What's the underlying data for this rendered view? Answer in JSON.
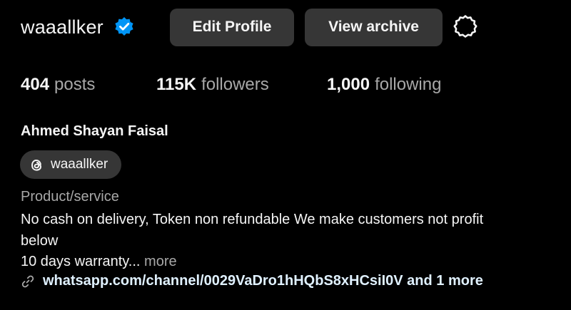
{
  "profile": {
    "username": "waaallker",
    "edit_profile_label": "Edit Profile",
    "view_archive_label": "View archive",
    "full_name": "Ahmed Shayan Faisal",
    "category": "Product/service"
  },
  "stats": {
    "posts": {
      "value": "404",
      "label": "posts"
    },
    "followers": {
      "value": "115K",
      "label": "followers"
    },
    "following": {
      "value": "1,000",
      "label": "following"
    }
  },
  "threads": {
    "handle": "waaallker"
  },
  "bio": {
    "line1": "No cash on delivery, Token non refundable We make customers not profit",
    "line2": "below",
    "line3": "10 days warranty...",
    "more_label": "more"
  },
  "link": {
    "text": "whatsapp.com/channel/0029VaDro1hHQbS8xHCsiI0V and 1 more"
  },
  "colors": {
    "background": "#000000",
    "button_bg": "#363636",
    "primary_text": "#f5f5f5",
    "secondary_text": "#a8a8a8",
    "verified_blue": "#0095f6",
    "link_text": "#e0f1ff"
  },
  "icons": {
    "verified": "verified-badge-icon",
    "settings": "gear-icon",
    "threads": "threads-icon",
    "link": "link-icon"
  }
}
